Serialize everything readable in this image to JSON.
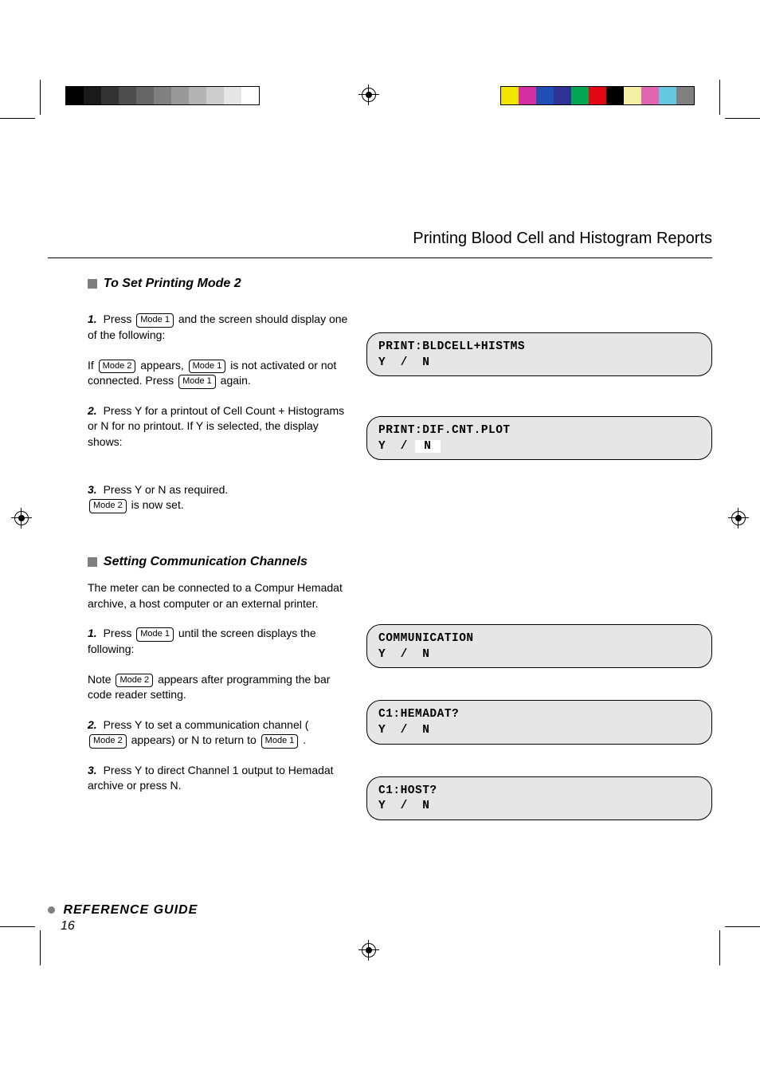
{
  "colorbars": {
    "left": [
      "#000000",
      "#1a1a1a",
      "#333333",
      "#4d4d4d",
      "#666666",
      "#808080",
      "#999999",
      "#b3b3b3",
      "#cccccc",
      "#e6e6e6",
      "#ffffff"
    ],
    "right": [
      "#f2e600",
      "#d62ea3",
      "#1f4fb3",
      "#2e3394",
      "#00a651",
      "#e30613",
      "#000000",
      "#f5f0a3",
      "#e066b0",
      "#66c7e0",
      "#808080"
    ]
  },
  "header": {
    "title": "Printing Blood Cell and Histogram Reports"
  },
  "section1": {
    "title": " To Set Printing Mode 2",
    "step1_num": "1.",
    "step1_a": "Press ",
    "step1_b": " and the screen should display one of the following:",
    "note_a": "If ",
    "note_b": " appears, ",
    "note_c": " is not activated or not connected. Press ",
    "note_d": " again.",
    "lcd1": {
      "l1": "PRINT:BLDCELL+HISTMS",
      "l2": "Y  /  N"
    },
    "step2_num": "2.",
    "step2_a": "Press Y for a printout of Cell Count + Histograms or N for no printout. If Y is selected, the display shows:",
    "lcd2": {
      "l1": "PRINT:DIF.CNT.PLOT",
      "l2_a": "Y  / ",
      "l2_hl": " N ",
      "l2_b": "        "
    },
    "step3_num": "3.",
    "step3_a": "Press Y or N as required.",
    "step3_b": " is now set."
  },
  "section2": {
    "title": " Setting Communication Channels",
    "intro": "The meter can be connected to a Compur Hemadat archive, a host computer or an external printer.",
    "step1_num": "1.",
    "step1_a": "Press ",
    "step1_b": " until the screen displays the following:",
    "lcd1": {
      "l1": "COMMUNICATION",
      "l2": "Y  /  N"
    },
    "step1_c": "Note ",
    "step1_d": " appears after programming the bar code reader setting.",
    "step2_num": "2.",
    "step2_a": "Press Y to set a communication channel (",
    "step2_b": " appears) or N to return to ",
    "step2_c": ".",
    "lcd2": {
      "l1": "C1:HEMADAT?",
      "l2": "Y  /  N"
    },
    "step3_num": "3.",
    "step3_a": "Press Y to direct Channel 1 output to Hemadat archive or press N.",
    "lcd3": {
      "l1": "C1:HOST?",
      "l2": "Y  /  N"
    }
  },
  "modes": {
    "m1": "Mode 1",
    "m2": "Mode 2"
  },
  "footer": {
    "title": "REFERENCE GUIDE",
    "pagenum": "16"
  }
}
